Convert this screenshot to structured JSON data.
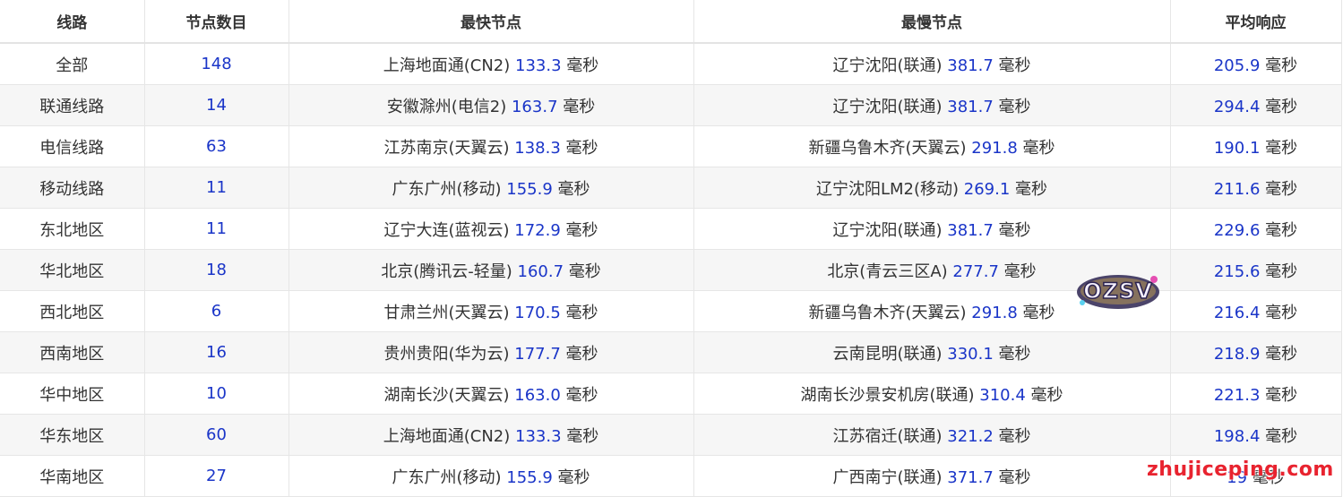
{
  "headers": [
    "线路",
    "节点数目",
    "最快节点",
    "最慢节点",
    "平均响应"
  ],
  "unit": "毫秒",
  "rows": [
    {
      "line": "全部",
      "count": "148",
      "fast_name": "上海地面通(CN2)",
      "fast_ms": "133.3",
      "slow_name": "辽宁沈阳(联通)",
      "slow_ms": "381.7",
      "avg_ms": "205.9"
    },
    {
      "line": "联通线路",
      "count": "14",
      "fast_name": "安徽滁州(电信2)",
      "fast_ms": "163.7",
      "slow_name": "辽宁沈阳(联通)",
      "slow_ms": "381.7",
      "avg_ms": "294.4"
    },
    {
      "line": "电信线路",
      "count": "63",
      "fast_name": "江苏南京(天翼云)",
      "fast_ms": "138.3",
      "slow_name": "新疆乌鲁木齐(天翼云)",
      "slow_ms": "291.8",
      "avg_ms": "190.1"
    },
    {
      "line": "移动线路",
      "count": "11",
      "fast_name": "广东广州(移动)",
      "fast_ms": "155.9",
      "slow_name": "辽宁沈阳LM2(移动)",
      "slow_ms": "269.1",
      "avg_ms": "211.6"
    },
    {
      "line": "东北地区",
      "count": "11",
      "fast_name": "辽宁大连(蓝视云)",
      "fast_ms": "172.9",
      "slow_name": "辽宁沈阳(联通)",
      "slow_ms": "381.7",
      "avg_ms": "229.6"
    },
    {
      "line": "华北地区",
      "count": "18",
      "fast_name": "北京(腾讯云-轻量)",
      "fast_ms": "160.7",
      "slow_name": "北京(青云三区A)",
      "slow_ms": "277.7",
      "avg_ms": "215.6"
    },
    {
      "line": "西北地区",
      "count": "6",
      "fast_name": "甘肃兰州(天翼云)",
      "fast_ms": "170.5",
      "slow_name": "新疆乌鲁木齐(天翼云)",
      "slow_ms": "291.8",
      "avg_ms": "216.4"
    },
    {
      "line": "西南地区",
      "count": "16",
      "fast_name": "贵州贵阳(华为云)",
      "fast_ms": "177.7",
      "slow_name": "云南昆明(联通)",
      "slow_ms": "330.1",
      "avg_ms": "218.9"
    },
    {
      "line": "华中地区",
      "count": "10",
      "fast_name": "湖南长沙(天翼云)",
      "fast_ms": "163.0",
      "slow_name": "湖南长沙景安机房(联通)",
      "slow_ms": "310.4",
      "avg_ms": "221.3"
    },
    {
      "line": "华东地区",
      "count": "60",
      "fast_name": "上海地面通(CN2)",
      "fast_ms": "133.3",
      "slow_name": "江苏宿迁(联通)",
      "slow_ms": "321.2",
      "avg_ms": "198.4"
    },
    {
      "line": "华南地区",
      "count": "27",
      "fast_name": "广东广州(移动)",
      "fast_ms": "155.9",
      "slow_name": "广西南宁(联通)",
      "slow_ms": "371.7",
      "avg_ms": "19"
    }
  ],
  "watermarks": {
    "logo_text": "OZSV",
    "site": "zhujiceping.com"
  },
  "colors": {
    "number": "#1a35c8",
    "text": "#333333",
    "row_alt": "#f6f6f6",
    "border": "#e6e6e6",
    "watermark_red": "#e8232f"
  }
}
